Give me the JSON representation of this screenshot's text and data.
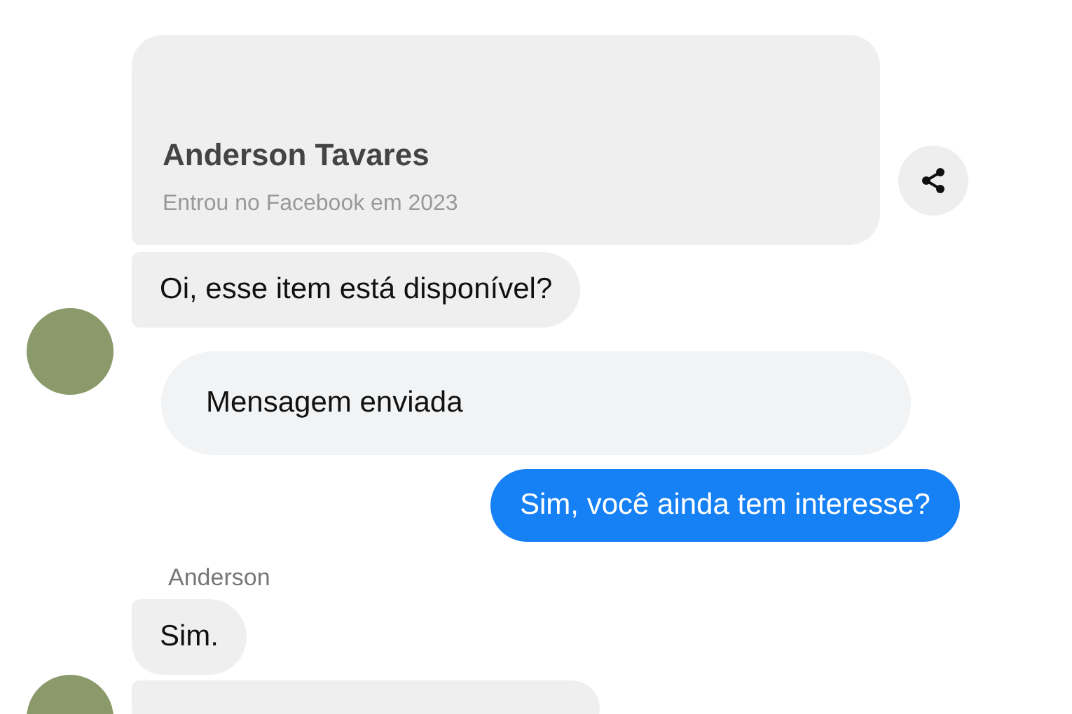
{
  "profile_card": {
    "name": "Anderson Tavares",
    "subtitle": "Entrou no Facebook em 2023"
  },
  "messages": [
    {
      "kind": "incoming",
      "text": "Oi, esse item está disponível?",
      "avatar": false
    },
    {
      "kind": "notice",
      "text": "Mensagem enviada",
      "avatar": true
    },
    {
      "kind": "outgoing",
      "text": "Sim, você ainda tem interesse?",
      "avatar": false
    },
    {
      "kind": "sender",
      "text": "Anderson",
      "avatar": false
    },
    {
      "kind": "incoming",
      "text": "Sim.",
      "avatar": false
    },
    {
      "kind": "incoming-partial",
      "avatar": true
    }
  ]
}
